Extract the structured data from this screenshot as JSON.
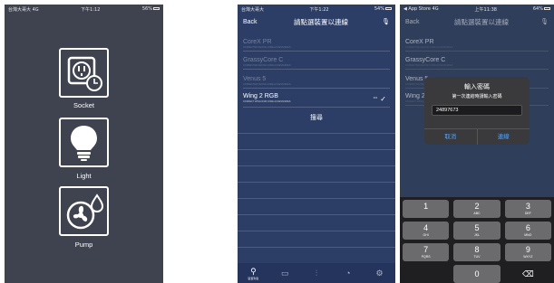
{
  "phone1": {
    "status": {
      "carrier": "台灣大哥大 4G",
      "time": "下午1:12",
      "battery": "56%"
    },
    "tiles": [
      {
        "label": "Socket"
      },
      {
        "label": "Light"
      },
      {
        "label": "Pump"
      }
    ]
  },
  "phone2": {
    "status": {
      "carrier": "台灣大哥大",
      "time": "下午1:22",
      "battery": "54%"
    },
    "back": "Back",
    "title": "請點選裝置以連線",
    "devices": [
      {
        "name": "CoreX PR",
        "sub": "CONNECTED DEVICE CORE ACCESSORIES"
      },
      {
        "name": "GrassyCore C",
        "sub": "CONNECTED DEVICE CORE ACCESSORIES"
      },
      {
        "name": "Venus 5",
        "sub": "CONNECTED DEVICE CORE ACCESSORIES"
      },
      {
        "name": "Wing 2 RGB",
        "sub": "CONNECT WING RGB CORE ACCESSORIES"
      }
    ],
    "scan": "搜尋",
    "tabs": [
      "裝置列表",
      "",
      "",
      "",
      ""
    ]
  },
  "phone3": {
    "status": {
      "carrier": "◀ App Store 4G",
      "time": "上午11:38",
      "battery": "64%"
    },
    "back": "Back",
    "title": "請點選裝置以連線",
    "devices": [
      {
        "name": "CoreX PR",
        "sub": "CONNECTED DEVICE CORE ACCESSORIES"
      },
      {
        "name": "GrassyCore C",
        "sub": "CONNECTED DEVICE CORE ACCESSORIES"
      },
      {
        "name": "Venus 5",
        "sub": "CONNECTED DEVICE CORE ACCESSORIES"
      },
      {
        "name": "Wing 2",
        "sub": "CONNECT WING RGB CORE ACCESSORIES"
      }
    ],
    "dialog": {
      "title": "輸入密碼",
      "message": "第一次連結時請輸入密碼",
      "value": "24897673",
      "cancel": "取消",
      "connect": "連線"
    },
    "keys": [
      {
        "n": "1",
        "l": ""
      },
      {
        "n": "2",
        "l": "ABC"
      },
      {
        "n": "3",
        "l": "DEF"
      },
      {
        "n": "4",
        "l": "GHI"
      },
      {
        "n": "5",
        "l": "JKL"
      },
      {
        "n": "6",
        "l": "MNO"
      },
      {
        "n": "7",
        "l": "PQRS"
      },
      {
        "n": "8",
        "l": "TUV"
      },
      {
        "n": "9",
        "l": "WXYZ"
      },
      {
        "n": "0",
        "l": ""
      }
    ],
    "delete_icon": "⌫"
  },
  "icons": {
    "socket": "socket-timer-icon",
    "light": "lightbulb-icon",
    "pump": "fan-water-drop-icon"
  }
}
